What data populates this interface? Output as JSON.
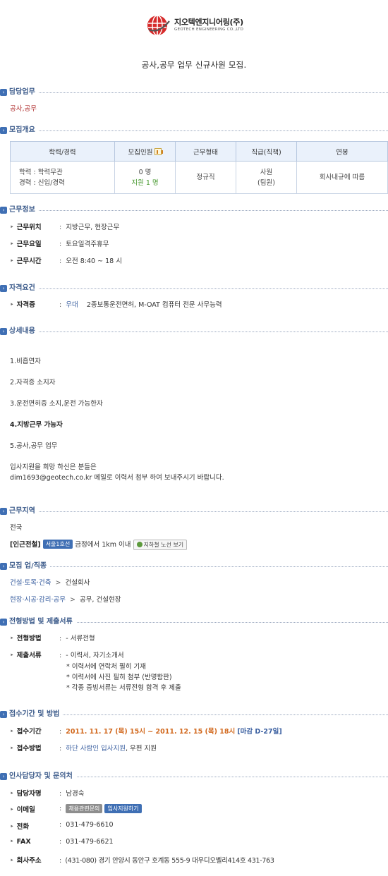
{
  "company": {
    "name_ko": "지오텍엔지니어링(주)",
    "name_en": "GEOTECH ENGINEERING CO.,LTD"
  },
  "page_title": "공사,공무 업무 신규사원 모집.",
  "sections": {
    "duty": "담당업무",
    "overview": "모집개요",
    "work_info": "근무정보",
    "qualification": "자격요건",
    "details": "상세내용",
    "area": "근무지역",
    "category": "모집 업/직종",
    "process": "전형방법 및 제출서류",
    "period": "접수기간 및 방법",
    "contact": "인사담당자 및 문의처"
  },
  "duty_text": "공사,공무",
  "overview_table": {
    "headers": [
      "학력/경력",
      "모집인원",
      "근무형태",
      "직급(직책)",
      "연봉"
    ],
    "education": "학력 : 학력무관",
    "career": "경력 : 신입/경력",
    "headcount": "0 명",
    "applicants": "지원 1 명",
    "work_type": "정규직",
    "rank": "사원",
    "position": "(팀원)",
    "salary": "회사내규에 따름"
  },
  "work_info": [
    {
      "label": "근무위치",
      "value": "지방근무, 현장근무"
    },
    {
      "label": "근무요일",
      "value": "토요일격주휴무"
    },
    {
      "label": "근무시간",
      "value": "오전 8:40 ~ 18 시"
    }
  ],
  "qualification": {
    "label": "자격증",
    "pref": "우대",
    "value": "2종보통운전면허, M-OAT 컴퓨터 전문 사무능력"
  },
  "details": {
    "items": [
      "1.비흡연자",
      "2.자격증 소지자",
      "3.운전면허증 소지,운전 가능한자",
      "4.지방근무 가능자",
      "5.공사,공무 업무"
    ],
    "apply_1": "입사지원을 희망 하신은 분들은",
    "apply_2": "dim1693@geotech.co.kr  메일로 이력서 첨부 하여 보내주시기 바랍니다."
  },
  "area": {
    "region": "전국",
    "nearby_label": "[인근전철]",
    "line": "서울1호선",
    "nearby_text": "금정에서 1km 이내",
    "map_button": "지하철 노선 보기"
  },
  "categories": [
    {
      "parent": "건설·토목·건축",
      "child": "건설회사"
    },
    {
      "parent": "현장·시공·감리·공무",
      "child": "공무, 건설현장"
    }
  ],
  "process": {
    "method_label": "전형방법",
    "method": "- 서류전형",
    "docs_label": "제출서류",
    "docs": [
      "- 이력서, 자기소개서",
      "* 이력서에 연락처 필히 기재",
      "* 이력서에 사진 필히 첨부 (반명함판)",
      "* 각종 증빙서류는 서류전형 합격 후 제출"
    ]
  },
  "period": {
    "label": "접수기간",
    "value": "2011. 11. 17 (목) 15시 ~ 2011. 12. 15 (목) 18시",
    "deadline": "[마감 D-27일]",
    "method_label": "접수방법",
    "method_link": "하단 사람인 입사지원",
    "method_rest": ", 우편 지원"
  },
  "contact": {
    "person_label": "담당자명",
    "person": "남경숙",
    "email_label": "이메일",
    "email_btn1": "채용관련문의",
    "email_btn2": "입사지원하기",
    "phone_label": "전화",
    "phone": "031-479-6610",
    "fax_label": "FAX",
    "fax": "031-479-6621",
    "address_label": "회사주소",
    "address": "(431-080) 경기 안양시 동안구 호계동 555-9 대우디오벨리414호 431-763"
  },
  "colors": {
    "accent": "#3f6fb4",
    "section_title": "#3b5a8a",
    "header_bg": "#eaf1fb",
    "deadline": "#d2691e",
    "logo_red": "#d62b2b"
  }
}
